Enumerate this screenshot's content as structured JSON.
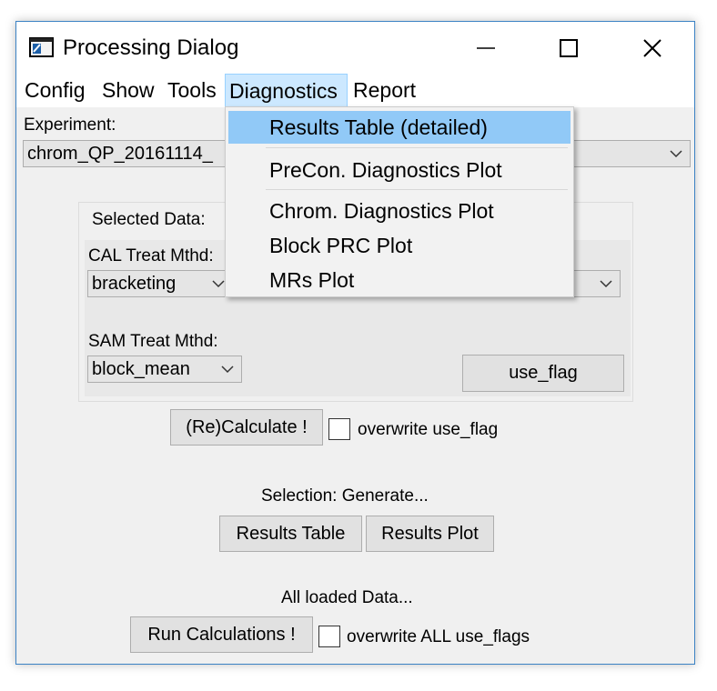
{
  "window": {
    "title": "Processing Dialog"
  },
  "menubar": {
    "items": [
      "Config",
      "Show",
      "Tools",
      "Diagnostics",
      "Report"
    ],
    "active": "Diagnostics"
  },
  "diagnostics_menu": {
    "items": [
      "Results Table (detailed)",
      "PreCon. Diagnostics Plot",
      "Chrom. Diagnostics Plot",
      "Block PRC Plot",
      "MRs Plot"
    ],
    "highlighted": "Results Table (detailed)"
  },
  "experiment": {
    "label": "Experiment:",
    "value": "chrom_QP_20161114_"
  },
  "selected_data": {
    "title": "Selected Data:",
    "cal_label": "CAL Treat Mthd:",
    "cal_value": "bracketing",
    "sam_label": "SAM Treat Mthd:",
    "sam_value": "block_mean",
    "use_flag_button": "use_flag"
  },
  "recalculate": {
    "button": "(Re)Calculate !",
    "checkbox_label": "overwrite use_flag"
  },
  "selection": {
    "label": "Selection: Generate...",
    "results_table": "Results Table",
    "results_plot": "Results Plot"
  },
  "all_data": {
    "label": "All loaded Data...",
    "run_button": "Run Calculations !",
    "checkbox_label": "overwrite ALL use_flags"
  },
  "colors": {
    "menu_highlight": "#91c9f7",
    "menu_active": "#cce8ff",
    "window_border": "#3b82c4"
  }
}
